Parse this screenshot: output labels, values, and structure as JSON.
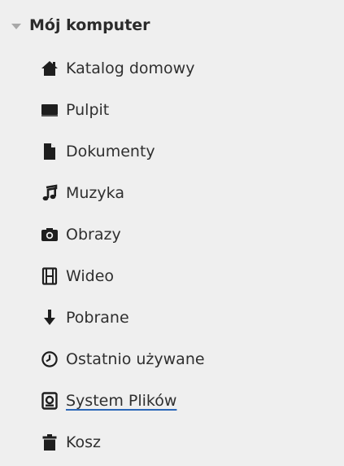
{
  "section": {
    "title": "Mój komputer",
    "expanded": true,
    "expander_icon": "triangle-down-icon"
  },
  "places": [
    {
      "label": "Katalog domowy",
      "icon": "home-icon"
    },
    {
      "label": "Pulpit",
      "icon": "desktop-icon"
    },
    {
      "label": "Dokumenty",
      "icon": "document-icon"
    },
    {
      "label": "Muzyka",
      "icon": "music-note-icon"
    },
    {
      "label": "Obrazy",
      "icon": "camera-icon"
    },
    {
      "label": "Wideo",
      "icon": "film-icon"
    },
    {
      "label": "Pobrane",
      "icon": "download-arrow-icon"
    },
    {
      "label": "Ostatnio używane",
      "icon": "clock-icon"
    },
    {
      "label": "System Plików",
      "icon": "drive-icon"
    },
    {
      "label": "Kosz",
      "icon": "trash-icon"
    }
  ],
  "colors": {
    "panel_background": "#efefef",
    "text": "#2f2f2f",
    "icon": "#1e1e1e",
    "underline_accent": "#2a66b8"
  }
}
